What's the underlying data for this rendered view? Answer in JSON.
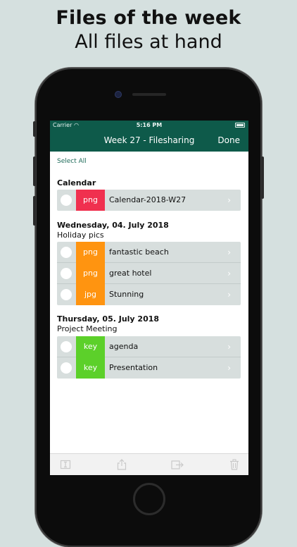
{
  "promo": {
    "title": "Files of the week",
    "subtitle": "All files at hand"
  },
  "status_bar": {
    "carrier": "Carrier",
    "time": "5:16 PM"
  },
  "nav": {
    "title": "Week 27 - Filesharing",
    "done_label": "Done"
  },
  "select_all_label": "Select All",
  "colors": {
    "bar": "#0e5a4a",
    "png_red": "#f0304f",
    "png_orange": "#ff9410",
    "key_green": "#5cd02a"
  },
  "sections": [
    {
      "title": "Calendar",
      "subtitle": "",
      "files": [
        {
          "type": "png",
          "name": "Calendar-2018-W27",
          "color": "#f0304f"
        }
      ]
    },
    {
      "title": "Wednesday, 04. July 2018",
      "subtitle": "Holiday pics",
      "files": [
        {
          "type": "png",
          "name": "fantastic beach",
          "color": "#ff9410"
        },
        {
          "type": "png",
          "name": "great hotel",
          "color": "#ff9410"
        },
        {
          "type": "jpg",
          "name": "Stunning",
          "color": "#ff9410"
        }
      ]
    },
    {
      "title": "Thursday, 05. July 2018",
      "subtitle": "Project Meeting",
      "files": [
        {
          "type": "key",
          "name": "agenda",
          "color": "#5cd02a"
        },
        {
          "type": "key",
          "name": "Presentation",
          "color": "#5cd02a"
        }
      ]
    }
  ],
  "toolbar_icons": [
    "rename-icon",
    "share-icon",
    "export-icon",
    "trash-icon"
  ]
}
